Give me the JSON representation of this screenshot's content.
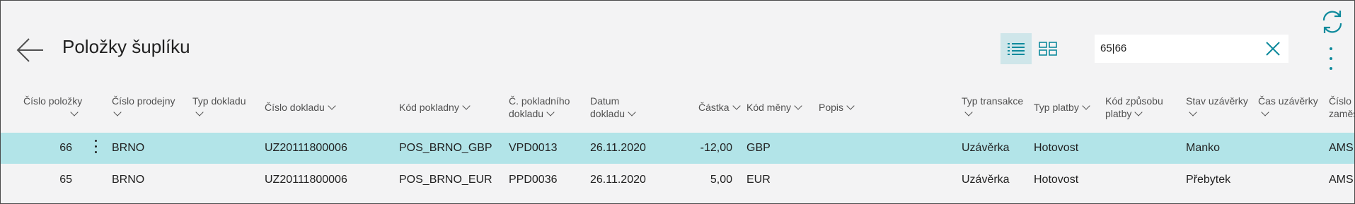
{
  "page": {
    "title": "Položky šuplíku"
  },
  "search": {
    "value": "65|66"
  },
  "columns": {
    "c1_l1": "Číslo položky",
    "c2_l1": "Číslo prodejny",
    "c3_l1": "Typ dokladu",
    "c4": "Číslo dokladu",
    "c5": "Kód pokladny",
    "c6_l1": "Č. pokladního",
    "c6_l2": "dokladu",
    "c7_l1": "Datum",
    "c7_l2": "dokladu",
    "c8": "Částka",
    "c9": "Kód měny",
    "c10": "Popis",
    "c11_l1": "Typ transakce",
    "c12": "Typ platby",
    "c13_l1": "Kód způsobu",
    "c13_l2": "platby",
    "c14_l1": "Stav uzávěrky",
    "c15_l1": "Čas uzávěrky",
    "c16_l1": "Číslo",
    "c16_l2": "zaměs"
  },
  "rows": [
    {
      "no": "66",
      "store": "BRNO",
      "doc_no": "UZ20111800006",
      "register": "POS_BRNO_GBP",
      "pos_doc": "VPD0013",
      "date": "26.11.2020",
      "amount": "-12,00",
      "currency": "GBP",
      "tx_type": "Uzávěrka",
      "pay_type": "Hotovost",
      "state": "Manko",
      "emp": "AMS"
    },
    {
      "no": "65",
      "store": "BRNO",
      "doc_no": "UZ20111800006",
      "register": "POS_BRNO_EUR",
      "pos_doc": "PPD0036",
      "date": "26.11.2020",
      "amount": "5,00",
      "currency": "EUR",
      "tx_type": "Uzávěrka",
      "pay_type": "Hotovost",
      "state": "Přebytek",
      "emp": "AMS"
    }
  ],
  "colors": {
    "accent": "#0e8a9c",
    "selected_row": "#b2e4e8",
    "background": "#f3f3f4"
  }
}
